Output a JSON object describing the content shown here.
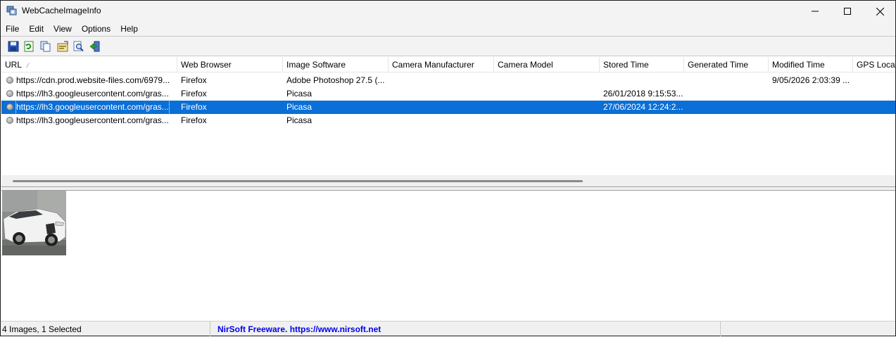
{
  "window": {
    "title": "WebCacheImageInfo"
  },
  "menu": [
    "File",
    "Edit",
    "View",
    "Options",
    "Help"
  ],
  "toolbar": {
    "buttons": [
      "save-icon",
      "refresh-icon",
      "copy-icon",
      "properties-icon",
      "find-icon",
      "exit-icon"
    ]
  },
  "columns": [
    "URL",
    "Web Browser",
    "Image Software",
    "Camera Manufacturer",
    "Camera Model",
    "Stored Time",
    "Generated Time",
    "Modified Time",
    "GPS Locat"
  ],
  "rows": [
    {
      "url": "https://cdn.prod.website-files.com/6979...",
      "browser": "Firefox",
      "software": "Adobe Photoshop 27.5 (...",
      "camera_manufacturer": "",
      "camera_model": "",
      "stored_time": "",
      "generated_time": "",
      "modified_time": "9/05/2026 2:03:39 ...",
      "gps": "",
      "selected": false
    },
    {
      "url": "https://lh3.googleusercontent.com/gras...",
      "browser": "Firefox",
      "software": "Picasa",
      "camera_manufacturer": "",
      "camera_model": "",
      "stored_time": "26/01/2018 9:15:53...",
      "generated_time": "",
      "modified_time": "",
      "gps": "",
      "selected": false
    },
    {
      "url": "https://lh3.googleusercontent.com/gras...",
      "browser": "Firefox",
      "software": "Picasa",
      "camera_manufacturer": "",
      "camera_model": "",
      "stored_time": "27/06/2024 12:24:2...",
      "generated_time": "",
      "modified_time": "",
      "gps": "",
      "selected": true
    },
    {
      "url": "https://lh3.googleusercontent.com/gras...",
      "browser": "Firefox",
      "software": "Picasa",
      "camera_manufacturer": "",
      "camera_model": "",
      "stored_time": "",
      "generated_time": "",
      "modified_time": "",
      "gps": "",
      "selected": false
    }
  ],
  "preview": {
    "image_icon": "car-photo-thumbnail"
  },
  "status": {
    "summary": "4 Images, 1 Selected",
    "link": "NirSoft Freeware. https://www.nirsoft.net"
  },
  "colors": {
    "selection": "#0a6fd6",
    "link": "#0000ee",
    "chrome": "#f3f3f3"
  }
}
